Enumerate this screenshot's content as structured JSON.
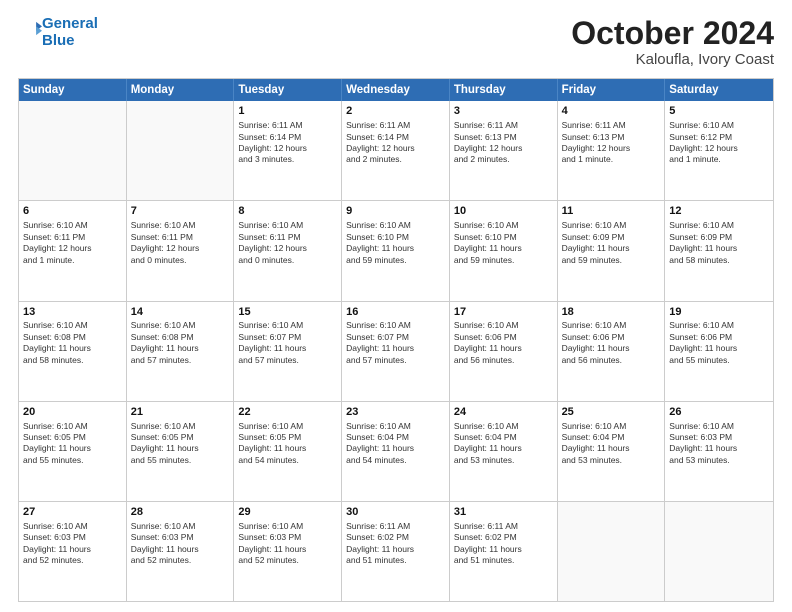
{
  "logo": {
    "line1": "General",
    "line2": "Blue"
  },
  "title": "October 2024",
  "subtitle": "Kaloufla, Ivory Coast",
  "days": [
    "Sunday",
    "Monday",
    "Tuesday",
    "Wednesday",
    "Thursday",
    "Friday",
    "Saturday"
  ],
  "weeks": [
    [
      {
        "day": "",
        "content": ""
      },
      {
        "day": "",
        "content": ""
      },
      {
        "day": "1",
        "content": "Sunrise: 6:11 AM\nSunset: 6:14 PM\nDaylight: 12 hours\nand 3 minutes."
      },
      {
        "day": "2",
        "content": "Sunrise: 6:11 AM\nSunset: 6:14 PM\nDaylight: 12 hours\nand 2 minutes."
      },
      {
        "day": "3",
        "content": "Sunrise: 6:11 AM\nSunset: 6:13 PM\nDaylight: 12 hours\nand 2 minutes."
      },
      {
        "day": "4",
        "content": "Sunrise: 6:11 AM\nSunset: 6:13 PM\nDaylight: 12 hours\nand 1 minute."
      },
      {
        "day": "5",
        "content": "Sunrise: 6:10 AM\nSunset: 6:12 PM\nDaylight: 12 hours\nand 1 minute."
      }
    ],
    [
      {
        "day": "6",
        "content": "Sunrise: 6:10 AM\nSunset: 6:11 PM\nDaylight: 12 hours\nand 1 minute."
      },
      {
        "day": "7",
        "content": "Sunrise: 6:10 AM\nSunset: 6:11 PM\nDaylight: 12 hours\nand 0 minutes."
      },
      {
        "day": "8",
        "content": "Sunrise: 6:10 AM\nSunset: 6:11 PM\nDaylight: 12 hours\nand 0 minutes."
      },
      {
        "day": "9",
        "content": "Sunrise: 6:10 AM\nSunset: 6:10 PM\nDaylight: 11 hours\nand 59 minutes."
      },
      {
        "day": "10",
        "content": "Sunrise: 6:10 AM\nSunset: 6:10 PM\nDaylight: 11 hours\nand 59 minutes."
      },
      {
        "day": "11",
        "content": "Sunrise: 6:10 AM\nSunset: 6:09 PM\nDaylight: 11 hours\nand 59 minutes."
      },
      {
        "day": "12",
        "content": "Sunrise: 6:10 AM\nSunset: 6:09 PM\nDaylight: 11 hours\nand 58 minutes."
      }
    ],
    [
      {
        "day": "13",
        "content": "Sunrise: 6:10 AM\nSunset: 6:08 PM\nDaylight: 11 hours\nand 58 minutes."
      },
      {
        "day": "14",
        "content": "Sunrise: 6:10 AM\nSunset: 6:08 PM\nDaylight: 11 hours\nand 57 minutes."
      },
      {
        "day": "15",
        "content": "Sunrise: 6:10 AM\nSunset: 6:07 PM\nDaylight: 11 hours\nand 57 minutes."
      },
      {
        "day": "16",
        "content": "Sunrise: 6:10 AM\nSunset: 6:07 PM\nDaylight: 11 hours\nand 57 minutes."
      },
      {
        "day": "17",
        "content": "Sunrise: 6:10 AM\nSunset: 6:06 PM\nDaylight: 11 hours\nand 56 minutes."
      },
      {
        "day": "18",
        "content": "Sunrise: 6:10 AM\nSunset: 6:06 PM\nDaylight: 11 hours\nand 56 minutes."
      },
      {
        "day": "19",
        "content": "Sunrise: 6:10 AM\nSunset: 6:06 PM\nDaylight: 11 hours\nand 55 minutes."
      }
    ],
    [
      {
        "day": "20",
        "content": "Sunrise: 6:10 AM\nSunset: 6:05 PM\nDaylight: 11 hours\nand 55 minutes."
      },
      {
        "day": "21",
        "content": "Sunrise: 6:10 AM\nSunset: 6:05 PM\nDaylight: 11 hours\nand 55 minutes."
      },
      {
        "day": "22",
        "content": "Sunrise: 6:10 AM\nSunset: 6:05 PM\nDaylight: 11 hours\nand 54 minutes."
      },
      {
        "day": "23",
        "content": "Sunrise: 6:10 AM\nSunset: 6:04 PM\nDaylight: 11 hours\nand 54 minutes."
      },
      {
        "day": "24",
        "content": "Sunrise: 6:10 AM\nSunset: 6:04 PM\nDaylight: 11 hours\nand 53 minutes."
      },
      {
        "day": "25",
        "content": "Sunrise: 6:10 AM\nSunset: 6:04 PM\nDaylight: 11 hours\nand 53 minutes."
      },
      {
        "day": "26",
        "content": "Sunrise: 6:10 AM\nSunset: 6:03 PM\nDaylight: 11 hours\nand 53 minutes."
      }
    ],
    [
      {
        "day": "27",
        "content": "Sunrise: 6:10 AM\nSunset: 6:03 PM\nDaylight: 11 hours\nand 52 minutes."
      },
      {
        "day": "28",
        "content": "Sunrise: 6:10 AM\nSunset: 6:03 PM\nDaylight: 11 hours\nand 52 minutes."
      },
      {
        "day": "29",
        "content": "Sunrise: 6:10 AM\nSunset: 6:03 PM\nDaylight: 11 hours\nand 52 minutes."
      },
      {
        "day": "30",
        "content": "Sunrise: 6:11 AM\nSunset: 6:02 PM\nDaylight: 11 hours\nand 51 minutes."
      },
      {
        "day": "31",
        "content": "Sunrise: 6:11 AM\nSunset: 6:02 PM\nDaylight: 11 hours\nand 51 minutes."
      },
      {
        "day": "",
        "content": ""
      },
      {
        "day": "",
        "content": ""
      }
    ]
  ]
}
